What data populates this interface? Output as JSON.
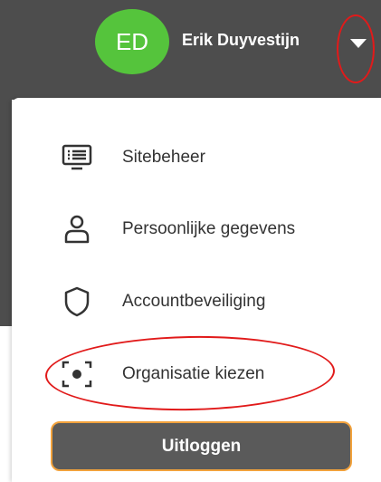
{
  "header": {
    "avatar_initials": "ED",
    "avatar_color": "#55c43c",
    "user_name": "Erik Duyvestijn",
    "menu_toggle_icon": "caret-down-icon"
  },
  "menu": {
    "items": [
      {
        "label": "Sitebeheer",
        "icon": "site-admin-icon"
      },
      {
        "label": "Persoonlijke gegevens",
        "icon": "user-icon"
      },
      {
        "label": "Accountbeveiliging",
        "icon": "shield-icon"
      },
      {
        "label": "Organisatie kiezen",
        "icon": "focus-frame-icon"
      }
    ],
    "logout_label": "Uitloggen"
  },
  "colors": {
    "header_bg": "#4d4d4d",
    "highlight": "#e11a1a",
    "logout_border": "#f2a23c",
    "logout_bg": "#5a5a5a"
  }
}
